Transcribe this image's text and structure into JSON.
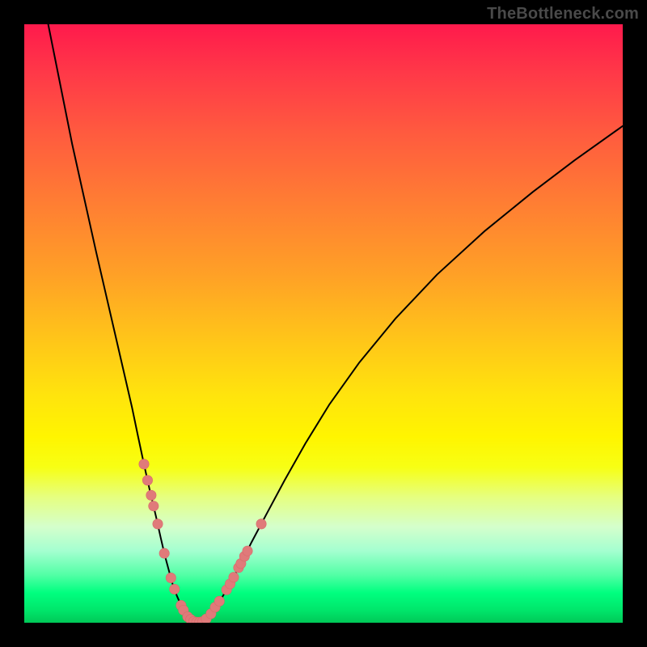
{
  "watermark": "TheBottleneck.com",
  "colors": {
    "curve_stroke": "#000000",
    "point_fill": "#e07a7a",
    "point_line": "#d86a6a",
    "background_black": "#000000"
  },
  "chart_data": {
    "type": "line",
    "title": "",
    "xlabel": "",
    "ylabel": "",
    "xlim": [
      0,
      100
    ],
    "ylim": [
      0,
      100
    ],
    "grid": false,
    "legend": false,
    "series": [
      {
        "name": "left-branch",
        "x": [
          4,
          6,
          8,
          10,
          12,
          13.5,
          15,
          16.5,
          18,
          19,
          20,
          21,
          22,
          22.8,
          23.5,
          24.2,
          24.8,
          25.5,
          26.2,
          26.9,
          27.6,
          28.3
        ],
        "values": [
          100,
          90,
          80,
          71,
          62,
          55.5,
          49,
          42.5,
          36,
          31.2,
          26.5,
          22,
          17.8,
          14.2,
          11.2,
          8.6,
          6.4,
          4.5,
          2.9,
          1.6,
          0.7,
          0.15
        ]
      },
      {
        "name": "right-branch",
        "x": [
          29.7,
          30.6,
          31.6,
          32.8,
          34.2,
          36,
          38,
          40.5,
          43.5,
          47,
          51,
          56,
          62,
          69,
          77,
          85,
          92,
          100
        ],
        "values": [
          0.15,
          0.8,
          2,
          3.8,
          6.2,
          9.5,
          13.5,
          18.2,
          23.8,
          30,
          36.5,
          43.5,
          50.8,
          58.2,
          65.5,
          72,
          77.3,
          83
        ]
      }
    ],
    "scatter": {
      "name": "highlight-points",
      "points": [
        {
          "x": 20.0,
          "y": 26.5
        },
        {
          "x": 20.6,
          "y": 23.8
        },
        {
          "x": 21.2,
          "y": 21.3
        },
        {
          "x": 21.6,
          "y": 19.5
        },
        {
          "x": 22.3,
          "y": 16.5
        },
        {
          "x": 23.4,
          "y": 11.6
        },
        {
          "x": 24.5,
          "y": 7.5
        },
        {
          "x": 25.1,
          "y": 5.6
        },
        {
          "x": 26.2,
          "y": 2.9
        },
        {
          "x": 26.6,
          "y": 2.1
        },
        {
          "x": 27.3,
          "y": 1.0
        },
        {
          "x": 27.8,
          "y": 0.55
        },
        {
          "x": 28.3,
          "y": 0.2
        },
        {
          "x": 28.8,
          "y": 0.1
        },
        {
          "x": 29.3,
          "y": 0.1
        },
        {
          "x": 29.8,
          "y": 0.2
        },
        {
          "x": 30.4,
          "y": 0.65
        },
        {
          "x": 31.2,
          "y": 1.5
        },
        {
          "x": 31.9,
          "y": 2.6
        },
        {
          "x": 32.6,
          "y": 3.6
        },
        {
          "x": 33.8,
          "y": 5.5
        },
        {
          "x": 34.4,
          "y": 6.5
        },
        {
          "x": 35.0,
          "y": 7.6
        },
        {
          "x": 35.8,
          "y": 9.2
        },
        {
          "x": 36.2,
          "y": 9.9
        },
        {
          "x": 36.8,
          "y": 11.1
        },
        {
          "x": 37.3,
          "y": 12.0
        },
        {
          "x": 39.6,
          "y": 16.5
        }
      ]
    }
  }
}
